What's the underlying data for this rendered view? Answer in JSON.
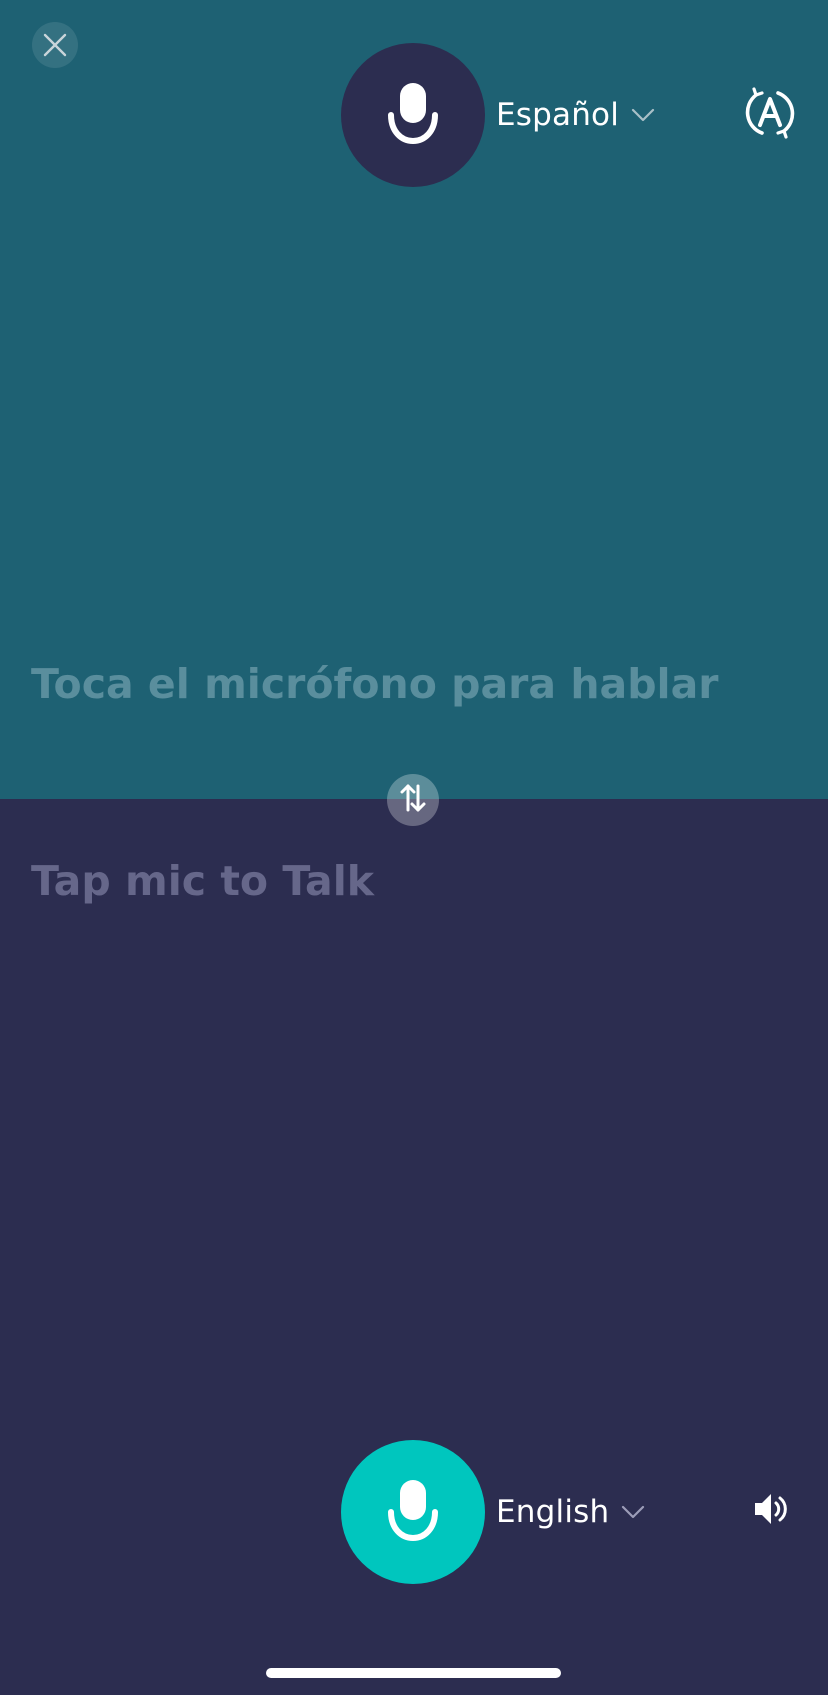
{
  "top_panel": {
    "language": "Español",
    "prompt": "Toca el micrófono para hablar",
    "mic_icon": "microphone-icon",
    "auto_icon": "auto-translate-icon"
  },
  "bottom_panel": {
    "language": "English",
    "prompt": "Tap mic to Talk",
    "mic_icon": "microphone-icon",
    "speaker_icon": "speaker-icon"
  },
  "controls": {
    "close_icon": "close-icon",
    "swap_icon": "swap-languages-icon"
  },
  "colors": {
    "top_background": "#1e6173",
    "bottom_background": "#2c2d50",
    "active_mic": "#00c6be",
    "inactive_mic": "#2c2d50"
  }
}
